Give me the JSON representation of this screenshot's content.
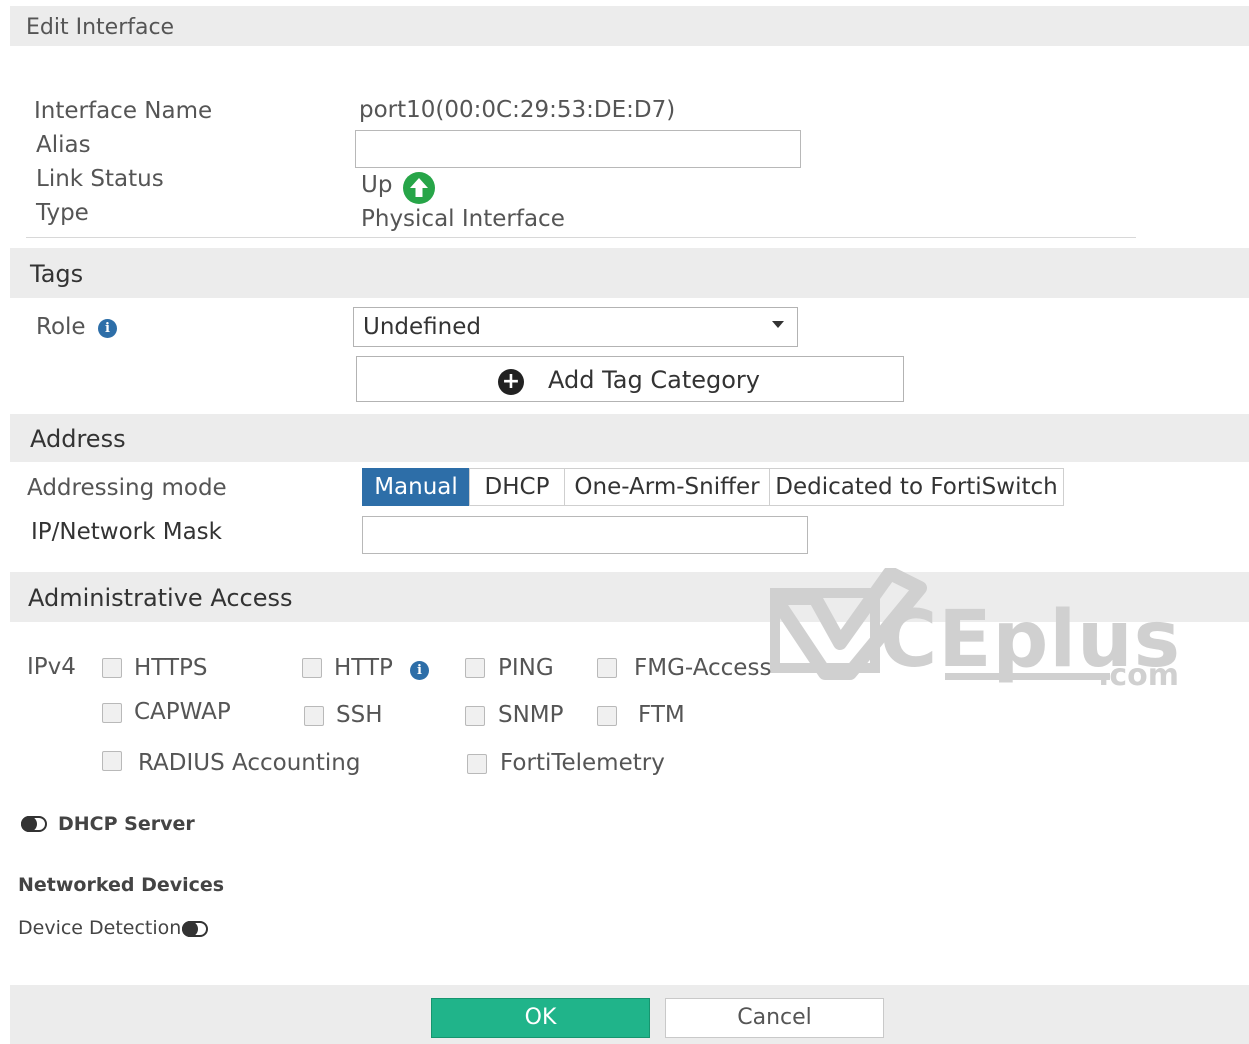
{
  "dialog": {
    "title": "Edit Interface"
  },
  "general": {
    "interface_name_label": "Interface Name",
    "interface_name_value": "port10(00:0C:29:53:DE:D7)",
    "alias_label": "Alias",
    "alias_value": "",
    "link_status_label": "Link Status",
    "link_status_value": "Up",
    "type_label": "Type",
    "type_value": "Physical Interface"
  },
  "tags": {
    "section_title": "Tags",
    "role_label": "Role",
    "role_selected": "Undefined",
    "add_tag_label": "Add Tag Category"
  },
  "address": {
    "section_title": "Address",
    "mode_label": "Addressing mode",
    "modes": [
      "Manual",
      "DHCP",
      "One-Arm-Sniffer",
      "Dedicated to FortiSwitch"
    ],
    "active_mode": "Manual",
    "ip_label": "IP/Network Mask",
    "ip_value": ""
  },
  "admin_access": {
    "section_title": "Administrative Access",
    "ipv4_label": "IPv4",
    "options": {
      "https": "HTTPS",
      "http": "HTTP",
      "ping": "PING",
      "fmg": "FMG-Access",
      "capwap": "CAPWAP",
      "ssh": "SSH",
      "snmp": "SNMP",
      "ftm": "FTM",
      "radius": "RADIUS Accounting",
      "fortitelemetry": "FortiTelemetry"
    }
  },
  "dhcp_server": {
    "label": "DHCP Server"
  },
  "networked_devices": {
    "title": "Networked Devices",
    "device_detection_label": "Device Detection"
  },
  "footer": {
    "ok_label": "OK",
    "cancel_label": "Cancel"
  },
  "watermark": {
    "text": "CEplus",
    "suffix": ".com"
  },
  "colors": {
    "accent": "#2d6ea8",
    "ok_button": "#20b48a",
    "status_up": "#27a548"
  }
}
